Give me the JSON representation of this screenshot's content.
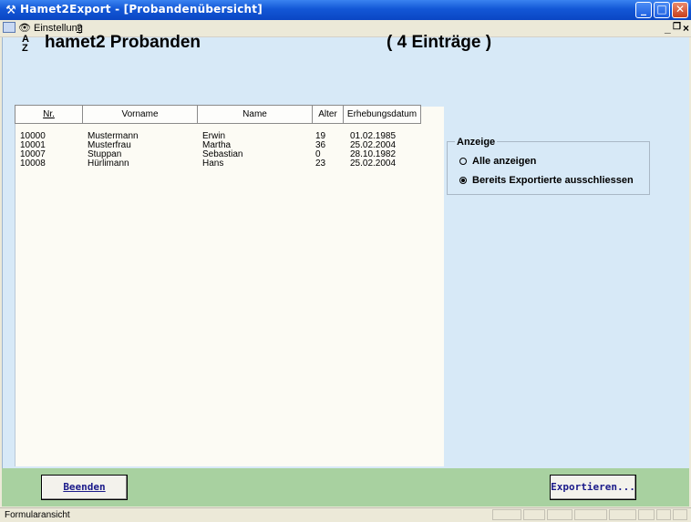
{
  "window": {
    "title": "Hamet2Export - [Probandenübersicht]",
    "min_glyph": "_",
    "max_glyph": "□",
    "close_glyph": "✕"
  },
  "menu": {
    "einstellung": "Einstellung",
    "help": "?",
    "mdi_min": "_",
    "mdi_restore": "❐",
    "mdi_close": "×"
  },
  "header": {
    "title": "hamet2 Probanden",
    "count": "( 4 Einträge )"
  },
  "table": {
    "columns": [
      "Nr.",
      "Vorname",
      "Name",
      "Alter",
      "Erhebungsdatum"
    ],
    "rows": [
      [
        "10000",
        "Mustermann",
        "Erwin",
        "19",
        "01.02.1985"
      ],
      [
        "10001",
        "Musterfrau",
        "Martha",
        "36",
        "25.02.2004"
      ],
      [
        "10007",
        "Stuppan",
        "Sebastian",
        "0",
        "28.10.1982"
      ],
      [
        "10008",
        "Hürlimann",
        "Hans",
        "23",
        "25.02.2004"
      ]
    ]
  },
  "anzeige": {
    "label": "Anzeige",
    "options": [
      "Alle anzeigen",
      "Bereits Exportierte ausschliessen"
    ],
    "selected": 1
  },
  "buttons": {
    "beenden": "Beenden",
    "exportieren": "Exportieren..."
  },
  "status": {
    "text": "Formularansicht"
  },
  "colors": {
    "client_bg": "#d7e9f7",
    "footer_bg": "#a8d1a0",
    "titlebar": "#0a46c4"
  }
}
